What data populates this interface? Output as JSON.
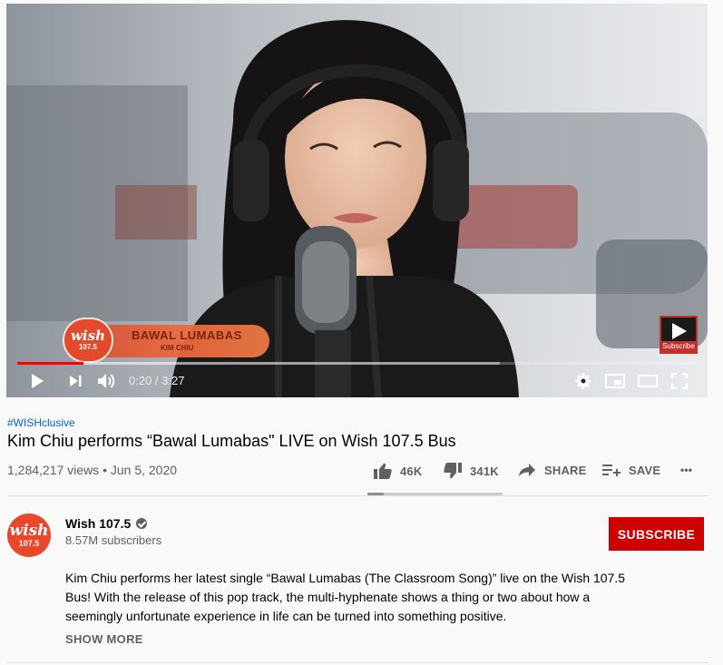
{
  "player": {
    "lower_third": {
      "logo_word": "wish",
      "logo_number": "107.5",
      "song": "BAWAL LUMABAS",
      "artist": "KIM CHIU"
    },
    "watermark": {
      "label": "Subscribe"
    },
    "progress": {
      "played_fraction": 0.097,
      "loaded_fraction": 0.71,
      "played_color": "#ff0000"
    },
    "time_display": "0:20 / 3:27",
    "icons": [
      "play-icon",
      "next-icon",
      "volume-icon",
      "settings-icon",
      "miniplayer-icon",
      "theater-icon",
      "fullscreen-icon"
    ]
  },
  "video": {
    "hashtag": "#WISHclusive",
    "title": "Kim Chiu performs “Bawal Lumabas\" LIVE on Wish 107.5 Bus",
    "meta": "1,284,217 views • Jun 5, 2020"
  },
  "actions": {
    "like_count": "46K",
    "dislike_count": "341K",
    "share_label": "SHARE",
    "save_label": "SAVE",
    "more_label": "•••"
  },
  "channel": {
    "avatar_word": "wish",
    "avatar_number": "107.5",
    "name": "Wish 107.5",
    "subscribers": "8.57M subscribers",
    "subscribe_label": "SUBSCRIBE",
    "brand_color": "#cc0000"
  },
  "description": {
    "text": "Kim Chiu performs her latest single “Bawal Lumabas (The Classroom Song)” live on the Wish 107.5 Bus! With the release of this pop track, the multi-hyphenate shows a thing or two about how a seemingly unfortunate experience in life can be turned into something positive.",
    "show_more_label": "SHOW MORE"
  }
}
